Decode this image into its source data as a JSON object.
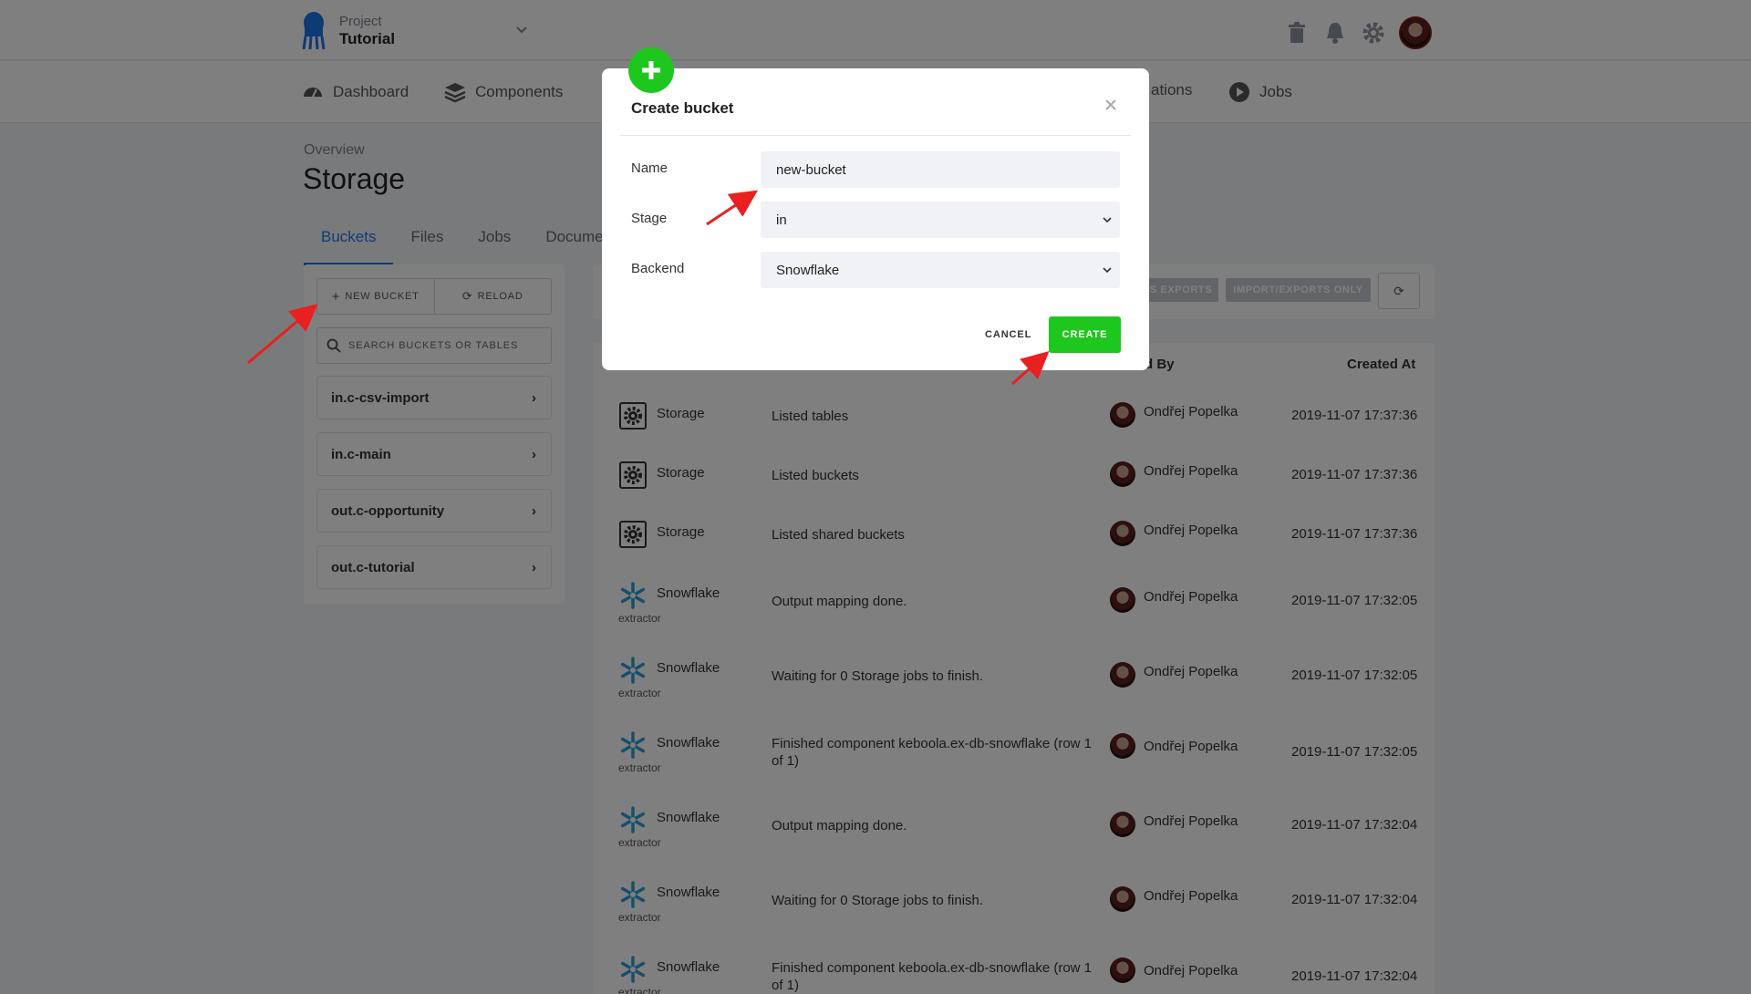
{
  "header": {
    "project_label": "Project",
    "project_name": "Tutorial"
  },
  "nav": {
    "dashboard": "Dashboard",
    "components": "Components",
    "orchestrations_partial": "ations",
    "jobs": "Jobs"
  },
  "breadcrumb": "Overview",
  "page_title": "Storage",
  "tabs": [
    "Buckets",
    "Files",
    "Jobs",
    "Documen"
  ],
  "sidebar": {
    "new_bucket": "NEW BUCKET",
    "reload": "RELOAD",
    "search_placeholder": "SEARCH BUCKETS OR TABLES",
    "buckets": [
      "in.c-csv-import",
      "in.c-main",
      "out.c-opportunity",
      "out.c-tutorial"
    ]
  },
  "filters": {
    "exports_partial": "S EXPORTS",
    "import_exports_only": "IMPORT/EXPORTS ONLY"
  },
  "table": {
    "headers": {
      "created_by_partial": "d By",
      "created_at": "Created At"
    },
    "rows": [
      {
        "component": "Storage",
        "sub": "",
        "icon": "gear-icon",
        "message": "Listed tables",
        "user": "Ondřej Popelka",
        "time": "2019-11-07 17:37:36"
      },
      {
        "component": "Storage",
        "sub": "",
        "icon": "gear-icon",
        "message": "Listed buckets",
        "user": "Ondřej Popelka",
        "time": "2019-11-07 17:37:36"
      },
      {
        "component": "Storage",
        "sub": "",
        "icon": "gear-icon",
        "message": "Listed shared buckets",
        "user": "Ondřej Popelka",
        "time": "2019-11-07 17:37:36"
      },
      {
        "component": "Snowflake",
        "sub": "extractor",
        "icon": "snowflake-icon",
        "message": "Output mapping done.",
        "user": "Ondřej Popelka",
        "time": "2019-11-07 17:32:05"
      },
      {
        "component": "Snowflake",
        "sub": "extractor",
        "icon": "snowflake-icon",
        "message": "Waiting for 0 Storage jobs to finish.",
        "user": "Ondřej Popelka",
        "time": "2019-11-07 17:32:05"
      },
      {
        "component": "Snowflake",
        "sub": "extractor",
        "icon": "snowflake-icon",
        "message": "Finished component keboola.ex-db-snowflake (row 1 of 1)",
        "user": "Ondřej Popelka",
        "time": "2019-11-07 17:32:05"
      },
      {
        "component": "Snowflake",
        "sub": "extractor",
        "icon": "snowflake-icon",
        "message": "Output mapping done.",
        "user": "Ondřej Popelka",
        "time": "2019-11-07 17:32:04"
      },
      {
        "component": "Snowflake",
        "sub": "extractor",
        "icon": "snowflake-icon",
        "message": "Waiting for 0 Storage jobs to finish.",
        "user": "Ondřej Popelka",
        "time": "2019-11-07 17:32:04"
      },
      {
        "component": "Snowflake",
        "sub": "extractor",
        "icon": "snowflake-icon",
        "message": "Finished component keboola.ex-db-snowflake (row 1 of 1)",
        "user": "Ondřej Popelka",
        "time": "2019-11-07 17:32:04"
      }
    ]
  },
  "modal": {
    "title": "Create bucket",
    "name_label": "Name",
    "name_value": "new-bucket",
    "stage_label": "Stage",
    "stage_value": "in",
    "backend_label": "Backend",
    "backend_value": "Snowflake",
    "cancel": "CANCEL",
    "create": "CREATE"
  },
  "colors": {
    "accent_blue": "#1f74e8",
    "create_green": "#1ec71e",
    "annotation_red": "#e8201f"
  }
}
